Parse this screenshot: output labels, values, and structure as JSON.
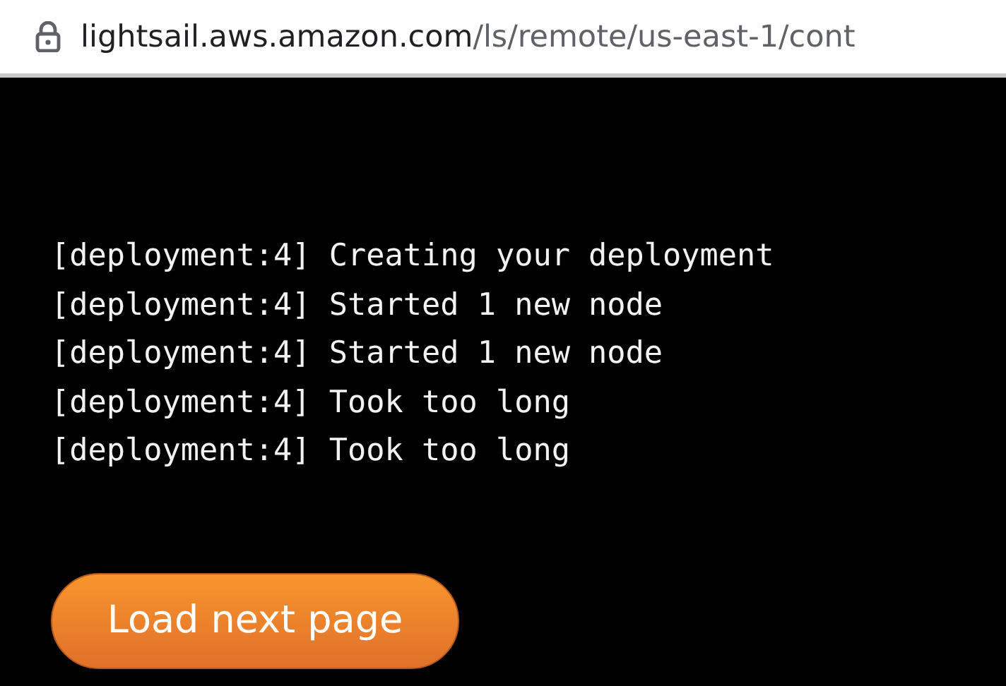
{
  "address_bar": {
    "host": "lightsail.aws.amazon.com",
    "path": "/ls/remote/us-east-1/cont",
    "secure": true
  },
  "log_lines": [
    "[deployment:4] Creating your deployment",
    "[deployment:4] Started 1 new node",
    "[deployment:4] Started 1 new node",
    "[deployment:4] Took too long",
    "[deployment:4] Took too long"
  ],
  "button": {
    "label": "Load next page"
  }
}
